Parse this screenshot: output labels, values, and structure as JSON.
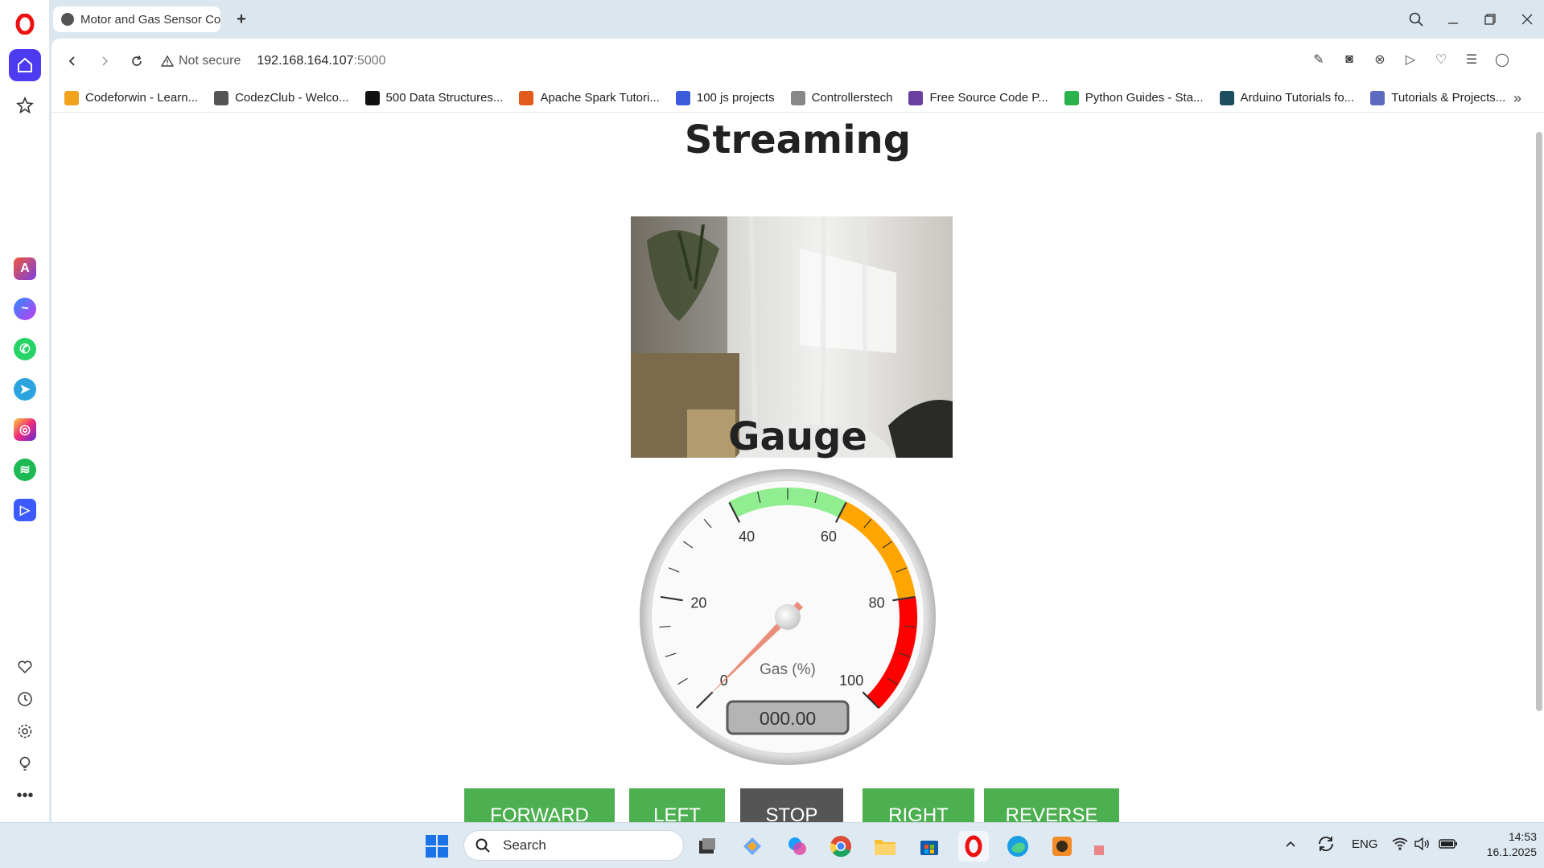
{
  "window": {
    "tab_title": "Motor and Gas Sensor Co",
    "new_tab": "+"
  },
  "addressbar": {
    "security": "Not secure",
    "url_host": "192.168.164.107",
    "url_port": ":5000"
  },
  "bookmarks": [
    {
      "label": "Codeforwin - Learn...",
      "color": "#f2a31b"
    },
    {
      "label": "CodezClub - Welco...",
      "color": "#555555"
    },
    {
      "label": "500 Data Structures...",
      "color": "#111111"
    },
    {
      "label": "Apache Spark Tutori...",
      "color": "#e25a1c"
    },
    {
      "label": "100 js projects",
      "color": "#3b5bdb"
    },
    {
      "label": "Controllerstech",
      "color": "#888888"
    },
    {
      "label": "Free Source Code P...",
      "color": "#6b3fa0"
    },
    {
      "label": "Python Guides - Sta...",
      "color": "#2bb24c"
    },
    {
      "label": "Arduino Tutorials fo...",
      "color": "#1d4e5f"
    },
    {
      "label": "Tutorials & Projects...",
      "color": "#5c6bc0"
    }
  ],
  "page": {
    "streaming_title": "Streaming",
    "gauge_title": "Gauge"
  },
  "gauge": {
    "label": "Gas (%)",
    "readout": "000.00",
    "value": 0,
    "min": 0,
    "max": 100,
    "major_ticks": [
      "0",
      "20",
      "40",
      "60",
      "80",
      "100"
    ],
    "zones": [
      {
        "from": 40,
        "to": 60,
        "color": "#90ee90"
      },
      {
        "from": 60,
        "to": 80,
        "color": "#ffa500"
      },
      {
        "from": 80,
        "to": 100,
        "color": "#ff0000"
      }
    ]
  },
  "controls": [
    "FORWARD",
    "LEFT",
    "STOP",
    "RIGHT",
    "REVERSE"
  ],
  "taskbar": {
    "search_label": "Search",
    "lang": "ENG",
    "time": "14:53",
    "date": "16.1.2025"
  }
}
